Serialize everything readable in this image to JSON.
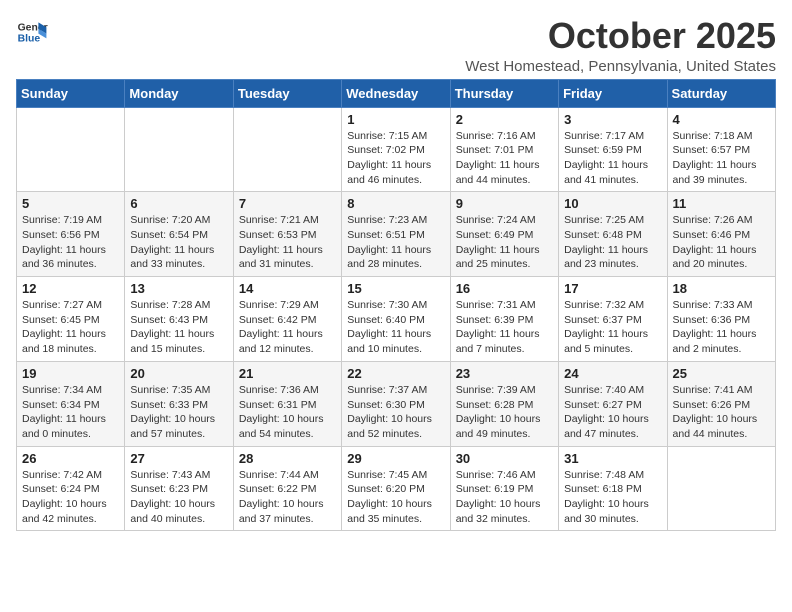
{
  "logo": {
    "text_general": "General",
    "text_blue": "Blue"
  },
  "title": "October 2025",
  "location": "West Homestead, Pennsylvania, United States",
  "weekdays": [
    "Sunday",
    "Monday",
    "Tuesday",
    "Wednesday",
    "Thursday",
    "Friday",
    "Saturday"
  ],
  "weeks": [
    [
      {
        "day": "",
        "info": ""
      },
      {
        "day": "",
        "info": ""
      },
      {
        "day": "",
        "info": ""
      },
      {
        "day": "1",
        "info": "Sunrise: 7:15 AM\nSunset: 7:02 PM\nDaylight: 11 hours and 46 minutes."
      },
      {
        "day": "2",
        "info": "Sunrise: 7:16 AM\nSunset: 7:01 PM\nDaylight: 11 hours and 44 minutes."
      },
      {
        "day": "3",
        "info": "Sunrise: 7:17 AM\nSunset: 6:59 PM\nDaylight: 11 hours and 41 minutes."
      },
      {
        "day": "4",
        "info": "Sunrise: 7:18 AM\nSunset: 6:57 PM\nDaylight: 11 hours and 39 minutes."
      }
    ],
    [
      {
        "day": "5",
        "info": "Sunrise: 7:19 AM\nSunset: 6:56 PM\nDaylight: 11 hours and 36 minutes."
      },
      {
        "day": "6",
        "info": "Sunrise: 7:20 AM\nSunset: 6:54 PM\nDaylight: 11 hours and 33 minutes."
      },
      {
        "day": "7",
        "info": "Sunrise: 7:21 AM\nSunset: 6:53 PM\nDaylight: 11 hours and 31 minutes."
      },
      {
        "day": "8",
        "info": "Sunrise: 7:23 AM\nSunset: 6:51 PM\nDaylight: 11 hours and 28 minutes."
      },
      {
        "day": "9",
        "info": "Sunrise: 7:24 AM\nSunset: 6:49 PM\nDaylight: 11 hours and 25 minutes."
      },
      {
        "day": "10",
        "info": "Sunrise: 7:25 AM\nSunset: 6:48 PM\nDaylight: 11 hours and 23 minutes."
      },
      {
        "day": "11",
        "info": "Sunrise: 7:26 AM\nSunset: 6:46 PM\nDaylight: 11 hours and 20 minutes."
      }
    ],
    [
      {
        "day": "12",
        "info": "Sunrise: 7:27 AM\nSunset: 6:45 PM\nDaylight: 11 hours and 18 minutes."
      },
      {
        "day": "13",
        "info": "Sunrise: 7:28 AM\nSunset: 6:43 PM\nDaylight: 11 hours and 15 minutes."
      },
      {
        "day": "14",
        "info": "Sunrise: 7:29 AM\nSunset: 6:42 PM\nDaylight: 11 hours and 12 minutes."
      },
      {
        "day": "15",
        "info": "Sunrise: 7:30 AM\nSunset: 6:40 PM\nDaylight: 11 hours and 10 minutes."
      },
      {
        "day": "16",
        "info": "Sunrise: 7:31 AM\nSunset: 6:39 PM\nDaylight: 11 hours and 7 minutes."
      },
      {
        "day": "17",
        "info": "Sunrise: 7:32 AM\nSunset: 6:37 PM\nDaylight: 11 hours and 5 minutes."
      },
      {
        "day": "18",
        "info": "Sunrise: 7:33 AM\nSunset: 6:36 PM\nDaylight: 11 hours and 2 minutes."
      }
    ],
    [
      {
        "day": "19",
        "info": "Sunrise: 7:34 AM\nSunset: 6:34 PM\nDaylight: 11 hours and 0 minutes."
      },
      {
        "day": "20",
        "info": "Sunrise: 7:35 AM\nSunset: 6:33 PM\nDaylight: 10 hours and 57 minutes."
      },
      {
        "day": "21",
        "info": "Sunrise: 7:36 AM\nSunset: 6:31 PM\nDaylight: 10 hours and 54 minutes."
      },
      {
        "day": "22",
        "info": "Sunrise: 7:37 AM\nSunset: 6:30 PM\nDaylight: 10 hours and 52 minutes."
      },
      {
        "day": "23",
        "info": "Sunrise: 7:39 AM\nSunset: 6:28 PM\nDaylight: 10 hours and 49 minutes."
      },
      {
        "day": "24",
        "info": "Sunrise: 7:40 AM\nSunset: 6:27 PM\nDaylight: 10 hours and 47 minutes."
      },
      {
        "day": "25",
        "info": "Sunrise: 7:41 AM\nSunset: 6:26 PM\nDaylight: 10 hours and 44 minutes."
      }
    ],
    [
      {
        "day": "26",
        "info": "Sunrise: 7:42 AM\nSunset: 6:24 PM\nDaylight: 10 hours and 42 minutes."
      },
      {
        "day": "27",
        "info": "Sunrise: 7:43 AM\nSunset: 6:23 PM\nDaylight: 10 hours and 40 minutes."
      },
      {
        "day": "28",
        "info": "Sunrise: 7:44 AM\nSunset: 6:22 PM\nDaylight: 10 hours and 37 minutes."
      },
      {
        "day": "29",
        "info": "Sunrise: 7:45 AM\nSunset: 6:20 PM\nDaylight: 10 hours and 35 minutes."
      },
      {
        "day": "30",
        "info": "Sunrise: 7:46 AM\nSunset: 6:19 PM\nDaylight: 10 hours and 32 minutes."
      },
      {
        "day": "31",
        "info": "Sunrise: 7:48 AM\nSunset: 6:18 PM\nDaylight: 10 hours and 30 minutes."
      },
      {
        "day": "",
        "info": ""
      }
    ]
  ]
}
